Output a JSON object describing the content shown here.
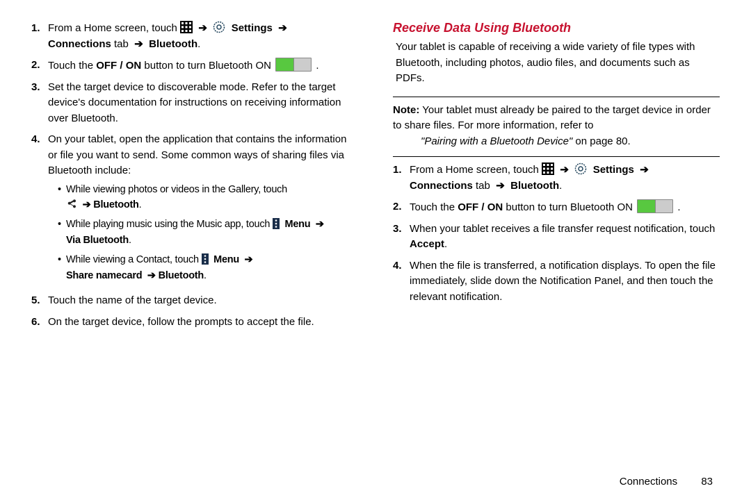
{
  "left": {
    "step1_a": "From a Home screen, touch ",
    "step1_settings": "Settings",
    "step1_conn": "Connections",
    "step1_tab": " tab",
    "step1_bt": "Bluetooth",
    "step2_a": "Touch the ",
    "step2_offon": "OFF / ON",
    "step2_b": " button to turn Bluetooth ON ",
    "step3": "Set the target device to discoverable mode. Refer to the target device's documentation for instructions on receiving information over Bluetooth.",
    "step4": "On your tablet, open the application that contains the information or file you want to send. Some common ways of sharing files via Bluetooth include:",
    "sub1_a": "While viewing photos or videos in the Gallery, touch ",
    "sub1_bt": "Bluetooth",
    "sub2_a": "While playing music using the Music app, touch ",
    "sub2_menu": "Menu",
    "sub2_via": "Via Bluetooth",
    "sub3_a": "While viewing a Contact, touch ",
    "sub3_menu": "Menu",
    "sub3_share": "Share namecard",
    "sub3_bt": "Bluetooth",
    "step5": "Touch the name of the target device.",
    "step6": "On the target device, follow the prompts to accept the file."
  },
  "right": {
    "heading": "Receive Data Using Bluetooth",
    "lead": "Your tablet is capable of receiving a wide variety of file types with Bluetooth, including photos, audio files, and documents such as PDFs.",
    "note_label": "Note:",
    "note_a": "Your tablet must already be paired to the target device in order to share files. For more information, refer to ",
    "note_ref": "\"Pairing with a Bluetooth Device\"",
    "note_page": " on page 80.",
    "step1_a": "From a Home screen, touch ",
    "step1_settings": "Settings",
    "step1_conn": "Connections",
    "step1_tab": " tab",
    "step1_bt": "Bluetooth",
    "step2_a": "Touch the ",
    "step2_offon": "OFF / ON",
    "step2_b": " button to turn Bluetooth ON ",
    "step3_a": "When your tablet receives a file transfer request notification, touch ",
    "step3_accept": "Accept",
    "step4": "When the file is transferred, a notification displays. To open the file immediately, slide down the Notification Panel, and then touch the relevant notification."
  },
  "footer": {
    "section": "Connections",
    "page": "83"
  },
  "nums": [
    "1.",
    "2.",
    "3.",
    "4.",
    "5.",
    "6."
  ],
  "arrow": "➔",
  "period": "."
}
